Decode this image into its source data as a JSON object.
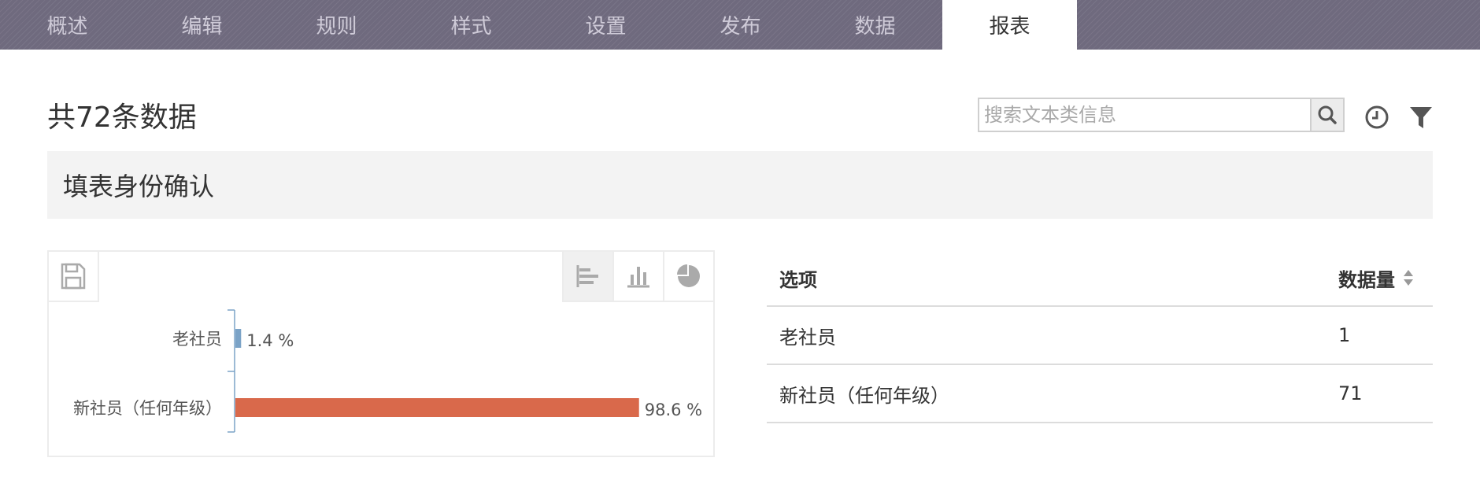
{
  "nav": {
    "tabs": [
      {
        "label": "概述"
      },
      {
        "label": "编辑"
      },
      {
        "label": "规则"
      },
      {
        "label": "样式"
      },
      {
        "label": "设置"
      },
      {
        "label": "发布"
      },
      {
        "label": "数据"
      },
      {
        "label": "报表"
      }
    ],
    "active_tab": "报表"
  },
  "summary": {
    "count_text": "共72条数据"
  },
  "search": {
    "placeholder": "搜索文本类信息",
    "value": ""
  },
  "toolbar": {
    "search_icon": "search-icon",
    "history_icon": "clock-icon",
    "filter_icon": "filter-icon"
  },
  "section": {
    "title": "填表身份确认"
  },
  "chart_controls": {
    "save_icon": "save-icon",
    "types": [
      "horizontal-bar-chart-icon",
      "vertical-bar-chart-icon",
      "pie-chart-icon"
    ],
    "active_type": "horizontal-bar-chart-icon"
  },
  "chart_data": {
    "type": "bar",
    "orientation": "horizontal",
    "categories": [
      "老社员",
      "新社员（任何年级）"
    ],
    "values": [
      1.4,
      98.6
    ],
    "value_labels": [
      "1.4 %",
      "98.6 %"
    ],
    "colors": [
      "#7ba3c7",
      "#d9694b"
    ],
    "xlim": [
      0,
      100
    ]
  },
  "table": {
    "headers": [
      "选项",
      "数据量"
    ],
    "rows": [
      {
        "option": "老社员",
        "count": "1"
      },
      {
        "option": "新社员（任何年级）",
        "count": "71"
      }
    ]
  }
}
